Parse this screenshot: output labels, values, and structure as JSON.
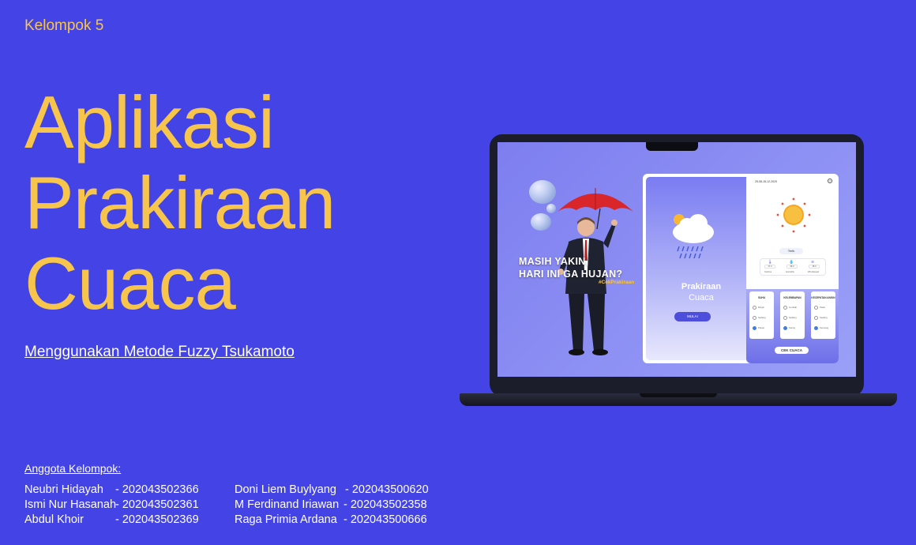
{
  "group_label": "Kelompok 5",
  "title_lines": [
    "Aplikasi",
    "Prakiraan",
    "Cuaca"
  ],
  "subtitle": "Menggunakan Metode Fuzzy Tsukamoto",
  "members_heading": "Anggota Kelompok:",
  "members": [
    {
      "name": "Neubri Hidayah",
      "id": "- 202043502366"
    },
    {
      "name": "Ismi Nur Hasanah",
      "id": "- 202043502361"
    },
    {
      "name": "Abdul Khoir",
      "id": "- 202043502369"
    },
    {
      "name": "Doni Liem Buylyang",
      "id": "- 202043500620"
    },
    {
      "name": "M Ferdinand Iriawan",
      "id": "- 202043502358"
    },
    {
      "name": "Raga Primia Ardana",
      "id": "- 202043500666"
    }
  ],
  "mockup": {
    "poster": {
      "line1": "MASIH YAKIN,",
      "line2": "HARI INI GA HUJAN?",
      "hashtag": "#CekPrakiraan"
    },
    "splash": {
      "title": "Prakiraan",
      "subtitle": "Cuaca",
      "button": "MULAI"
    },
    "result": {
      "date": "25-08-15-12-2020",
      "condition": "Terik",
      "stats": [
        {
          "value": "37.0",
          "label": "Celcius"
        },
        {
          "value": "68.0",
          "label": "Humidity"
        },
        {
          "value": "28.0",
          "label": "Windspeed"
        }
      ],
      "cards": [
        {
          "title": "SUHU",
          "options": [
            "Dingin",
            "Sedang",
            "Panas"
          ],
          "selected": 2
        },
        {
          "title": "KELEMBAPAN",
          "options": [
            "Lembab",
            "Sedang",
            "Kering"
          ],
          "selected": 2
        },
        {
          "title": "KECEPATAN ANGIN",
          "options": [
            "Pelan",
            "Sedang",
            "Kencang"
          ],
          "selected": 2
        }
      ],
      "button": "CEK CUACA"
    }
  },
  "colors": {
    "background": "#4343e6",
    "accent": "#f7c44c",
    "text": "#ffffff"
  }
}
